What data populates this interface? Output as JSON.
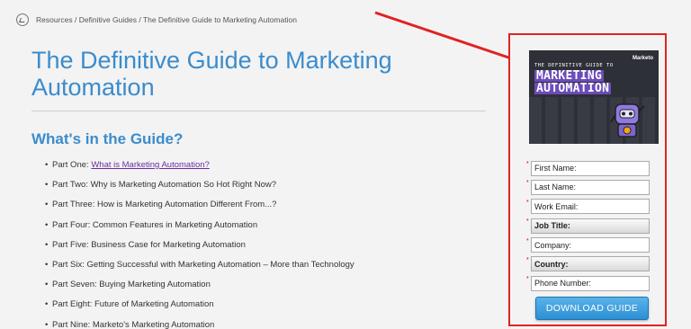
{
  "breadcrumb": {
    "text": "Resources / Definitive Guides / The Definitive Guide to Marketing Automation"
  },
  "title": {
    "line1": "The Definitive Guide to Marketing",
    "line2": "Automation"
  },
  "guide_heading": "What's in the Guide?",
  "parts": [
    {
      "label": "Part One: ",
      "link": "What is Marketing Automation?"
    },
    {
      "label": "Part Two: Why is Marketing Automation So Hot Right Now?"
    },
    {
      "label": "Part Three: How is Marketing Automation Different From...?"
    },
    {
      "label": "Part Four: Common Features in Marketing Automation"
    },
    {
      "label": "Part Five: Business Case for Marketing Automation"
    },
    {
      "label": "Part Six: Getting Successful with Marketing Automation – More than Technology"
    },
    {
      "label": "Part Seven: Buying Marketing Automation"
    },
    {
      "label": "Part Eight: Future of Marketing Automation"
    },
    {
      "label": "Part Nine: Marketo's Marketing Automation"
    }
  ],
  "cover": {
    "small_title": "THE DEFINITIVE GUIDE TO",
    "big_line1": "MARKETING",
    "big_line2": "AUTOMATION",
    "brand": "Marketo"
  },
  "form": {
    "fields": [
      {
        "placeholder": "First Name:"
      },
      {
        "placeholder": "Last Name:"
      },
      {
        "placeholder": "Work Email:"
      },
      {
        "placeholder": "Job Title:"
      },
      {
        "placeholder": "Company:"
      },
      {
        "placeholder": "Country:"
      },
      {
        "placeholder": "Phone Number:"
      }
    ],
    "required_marker": "*",
    "button_label": "DOWNLOAD GUIDE"
  },
  "colors": {
    "accent": "#3b8ccc",
    "link": "#6a2fa0",
    "annotation": "#e02222",
    "button": "#2c8fd3"
  }
}
